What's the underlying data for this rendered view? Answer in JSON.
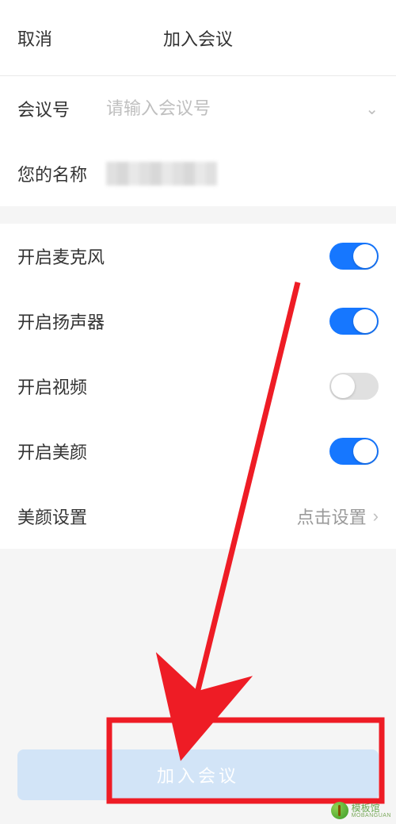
{
  "header": {
    "cancel": "取消",
    "title": "加入会议"
  },
  "inputs": {
    "meeting_id_label": "会议号",
    "meeting_id_placeholder": "请输入会议号",
    "name_label": "您的名称"
  },
  "options": {
    "mic_label": "开启麦克风",
    "mic_on": true,
    "speaker_label": "开启扬声器",
    "speaker_on": true,
    "video_label": "开启视频",
    "video_on": false,
    "beauty_label": "开启美颜",
    "beauty_on": true,
    "beauty_settings_label": "美颜设置",
    "beauty_settings_value": "点击设置"
  },
  "cta": {
    "join_label": "加入会议"
  },
  "watermark": {
    "brand": "模板馆",
    "sub": "MOBANGUAN"
  }
}
